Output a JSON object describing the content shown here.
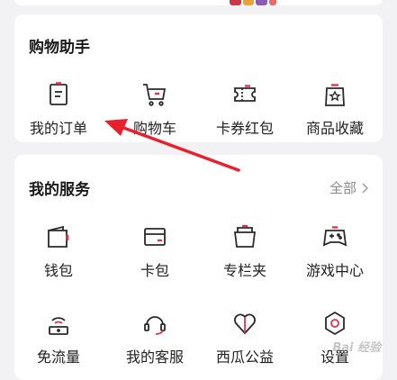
{
  "colors": {
    "accent": "#e0344b",
    "arrow": "#e8202e",
    "icon_stroke": "#2a2a2a"
  },
  "shopping_helper": {
    "title": "购物助手",
    "items": [
      {
        "label": "我的订单",
        "icon": "order-list-icon"
      },
      {
        "label": "购物车",
        "icon": "shopping-cart-icon"
      },
      {
        "label": "卡券红包",
        "icon": "coupon-ticket-icon"
      },
      {
        "label": "商品收藏",
        "icon": "favorite-bag-icon"
      }
    ]
  },
  "my_services": {
    "title": "我的服务",
    "more_label": "全部",
    "items": [
      {
        "label": "钱包",
        "icon": "wallet-icon"
      },
      {
        "label": "卡包",
        "icon": "card-holder-icon"
      },
      {
        "label": "专栏夹",
        "icon": "column-folder-icon"
      },
      {
        "label": "游戏中心",
        "icon": "gamepad-icon"
      },
      {
        "label": "免流量",
        "icon": "free-data-icon"
      },
      {
        "label": "我的客服",
        "icon": "customer-service-icon"
      },
      {
        "label": "西瓜公益",
        "icon": "charity-heart-icon"
      },
      {
        "label": "设置",
        "icon": "settings-gear-icon"
      }
    ]
  }
}
